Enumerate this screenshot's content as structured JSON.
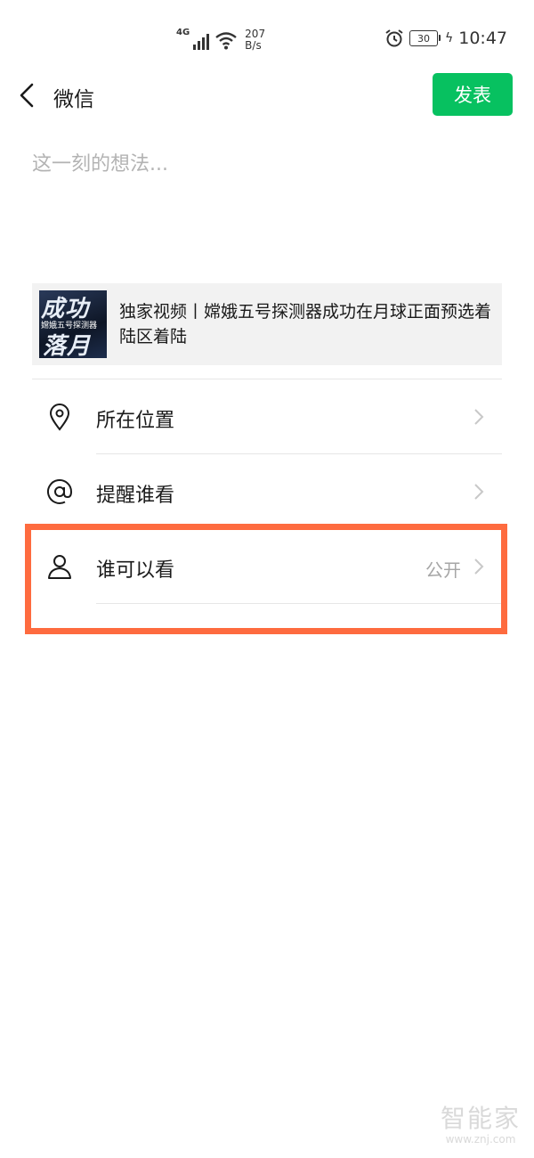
{
  "status_bar": {
    "network": "4G",
    "speed_value": "207",
    "speed_unit": "B/s",
    "battery": "30",
    "time": "10:47"
  },
  "nav": {
    "title": "微信",
    "publish_label": "发表"
  },
  "compose": {
    "placeholder": "这一刻的想法..."
  },
  "share_card": {
    "thumb_line1": "成功",
    "thumb_line2": "嫦娥五号探测器",
    "thumb_line3": "落月",
    "title": "独家视频丨嫦娥五号探测器成功在月球正面预选着陆区着陆"
  },
  "options": [
    {
      "label": "所在位置",
      "icon": "location-pin-icon",
      "value": ""
    },
    {
      "label": "提醒谁看",
      "icon": "at-sign-icon",
      "value": ""
    },
    {
      "label": "谁可以看",
      "icon": "person-icon",
      "value": "公开"
    }
  ],
  "colors": {
    "accent": "#07c160",
    "highlight": "#fe6b3f"
  },
  "watermark": {
    "name": "智能家",
    "url": "www.znj.com"
  }
}
